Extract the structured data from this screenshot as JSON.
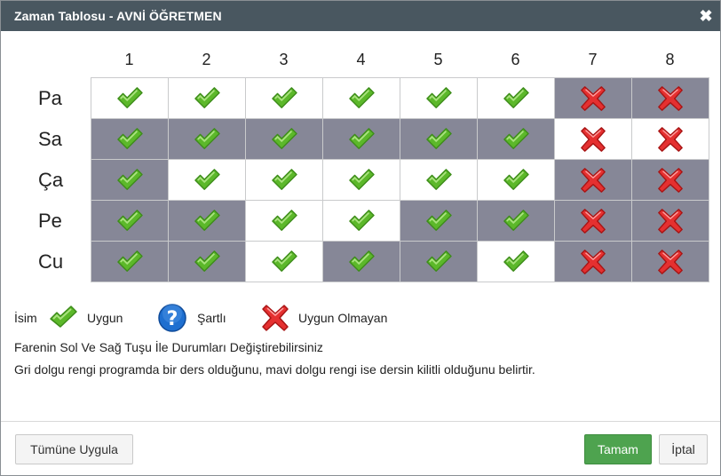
{
  "window": {
    "title": "Zaman Tablosu - AVNİ ÖĞRETMEN",
    "close_icon": "close-icon"
  },
  "schedule": {
    "periods": [
      "1",
      "2",
      "3",
      "4",
      "5",
      "6",
      "7",
      "8"
    ],
    "rows": [
      {
        "day": "Pa",
        "cells": [
          {
            "status": "ok",
            "fill": "white"
          },
          {
            "status": "ok",
            "fill": "white"
          },
          {
            "status": "ok",
            "fill": "white"
          },
          {
            "status": "ok",
            "fill": "white"
          },
          {
            "status": "ok",
            "fill": "white"
          },
          {
            "status": "ok",
            "fill": "white"
          },
          {
            "status": "no",
            "fill": "gray"
          },
          {
            "status": "no",
            "fill": "gray"
          }
        ]
      },
      {
        "day": "Sa",
        "cells": [
          {
            "status": "ok",
            "fill": "gray"
          },
          {
            "status": "ok",
            "fill": "gray"
          },
          {
            "status": "ok",
            "fill": "gray"
          },
          {
            "status": "ok",
            "fill": "gray"
          },
          {
            "status": "ok",
            "fill": "gray"
          },
          {
            "status": "ok",
            "fill": "gray"
          },
          {
            "status": "no",
            "fill": "white"
          },
          {
            "status": "no",
            "fill": "white"
          }
        ]
      },
      {
        "day": "Ça",
        "cells": [
          {
            "status": "ok",
            "fill": "gray"
          },
          {
            "status": "ok",
            "fill": "white"
          },
          {
            "status": "ok",
            "fill": "white"
          },
          {
            "status": "ok",
            "fill": "white"
          },
          {
            "status": "ok",
            "fill": "white"
          },
          {
            "status": "ok",
            "fill": "white"
          },
          {
            "status": "no",
            "fill": "gray"
          },
          {
            "status": "no",
            "fill": "gray"
          }
        ]
      },
      {
        "day": "Pe",
        "cells": [
          {
            "status": "ok",
            "fill": "gray"
          },
          {
            "status": "ok",
            "fill": "gray"
          },
          {
            "status": "ok",
            "fill": "white"
          },
          {
            "status": "ok",
            "fill": "white"
          },
          {
            "status": "ok",
            "fill": "gray"
          },
          {
            "status": "ok",
            "fill": "gray"
          },
          {
            "status": "no",
            "fill": "gray"
          },
          {
            "status": "no",
            "fill": "gray"
          }
        ]
      },
      {
        "day": "Cu",
        "cells": [
          {
            "status": "ok",
            "fill": "gray"
          },
          {
            "status": "ok",
            "fill": "gray"
          },
          {
            "status": "ok",
            "fill": "white"
          },
          {
            "status": "ok",
            "fill": "gray"
          },
          {
            "status": "ok",
            "fill": "gray"
          },
          {
            "status": "ok",
            "fill": "white"
          },
          {
            "status": "no",
            "fill": "gray"
          },
          {
            "status": "no",
            "fill": "gray"
          }
        ]
      }
    ]
  },
  "legend": {
    "name_label": "İsim",
    "available_label": "Uygun",
    "conditional_label": "Şartlı",
    "unavailable_label": "Uygun Olmayan"
  },
  "info": {
    "line1": "Farenin Sol Ve Sağ Tuşu İle Durumları Değiştirebilirsiniz",
    "line2": "Gri dolgu rengi programda bir ders olduğunu, mavi dolgu rengi ise dersin kilitli olduğunu belirtir."
  },
  "buttons": {
    "apply_all": "Tümüne Uygula",
    "ok": "Tamam",
    "cancel": "İptal"
  },
  "colors": {
    "titlebar": "#495760",
    "gray_fill": "#868797",
    "ok_button": "#4ea34f",
    "check": "#5cb82a",
    "cross": "#e53030",
    "question": "#1e6fd0"
  }
}
